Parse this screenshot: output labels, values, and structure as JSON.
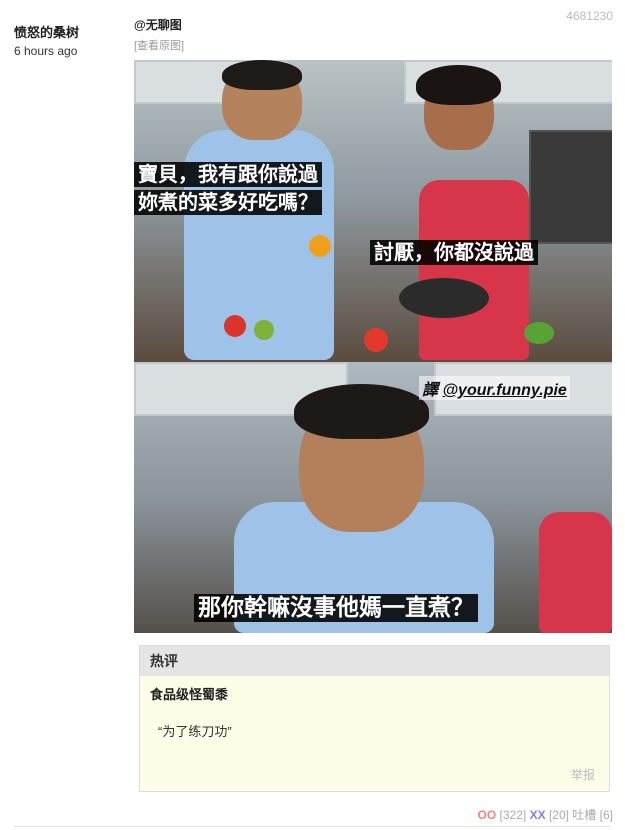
{
  "post": {
    "author": "愤怒的桑树",
    "time": "6 hours ago",
    "id": "4681230",
    "tag": "@无聊图",
    "view_original": "[查看原图]"
  },
  "image": {
    "sub1_line1": "寶貝，我有跟你說過",
    "sub1_line2": "妳煮的菜多好吃嗎？",
    "sub2": "討厭，你都沒說過",
    "credit_prefix": "譯 ",
    "credit_handle": "@your.funny.pie",
    "sub3": "那你幹嘛沒事他媽一直煮？"
  },
  "hot_comment": {
    "header": "热评",
    "user": "食品级怪蜀黍",
    "text": "“为了练刀功”",
    "report": "举报"
  },
  "votes": {
    "oo_label": "OO",
    "oo_count": "[322]",
    "xx_label": "XX",
    "xx_count": "[20]",
    "tucao_label": "吐槽",
    "tucao_count": "[6]"
  }
}
